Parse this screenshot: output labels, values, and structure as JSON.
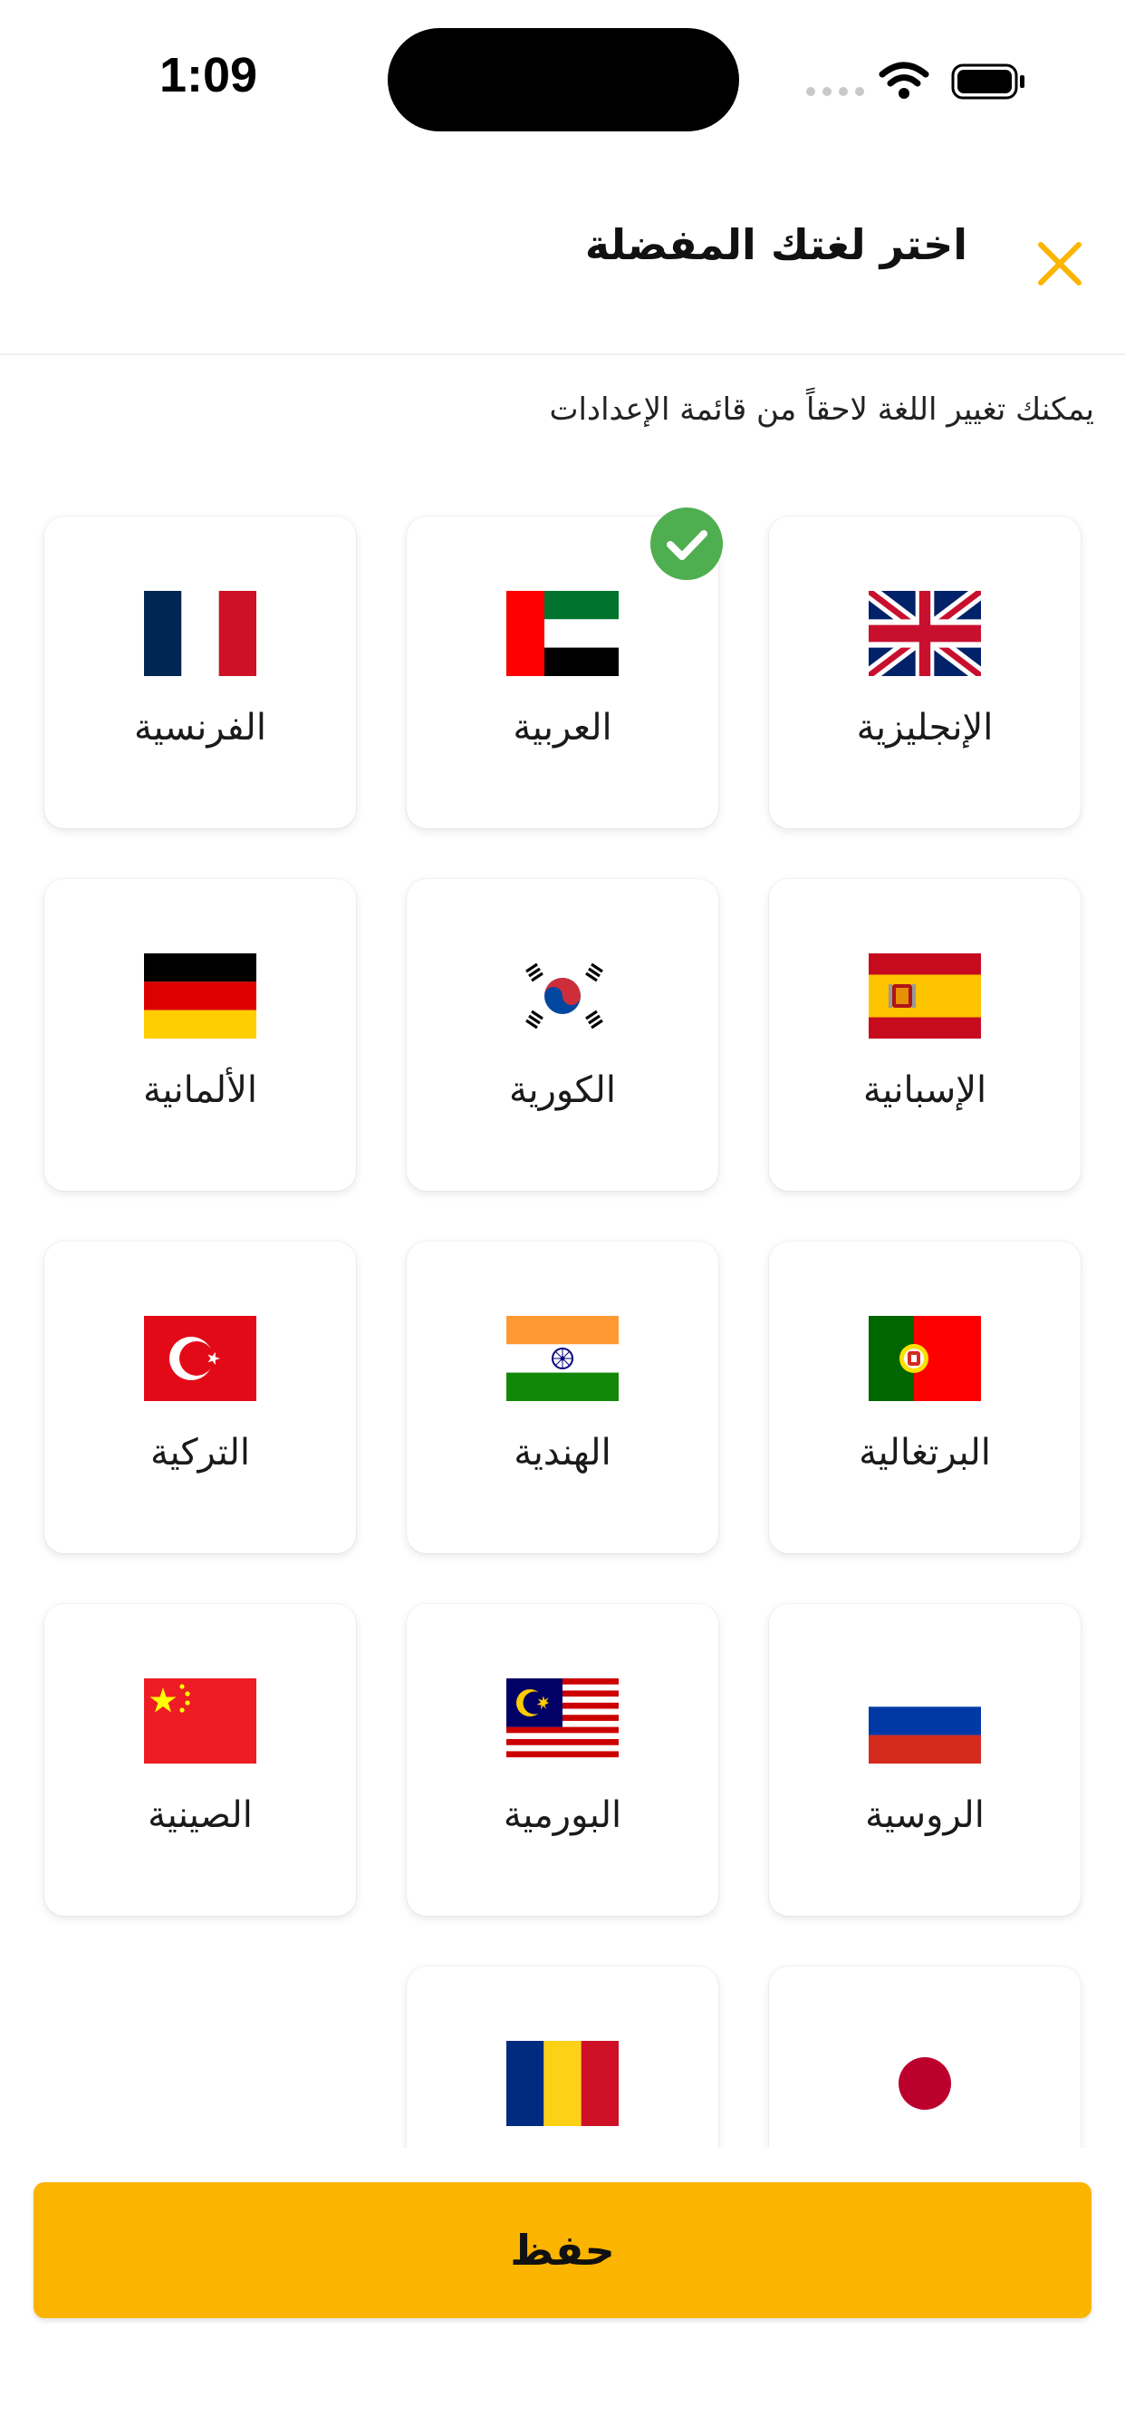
{
  "status_bar": {
    "time": "1:09"
  },
  "header": {
    "title": "اختر لغتك المفضلة",
    "close_icon": "close-icon"
  },
  "subtitle": "يمكنك تغيير اللغة لاحقاً من قائمة الإعدادات",
  "languages": [
    {
      "label": "الإنجليزية",
      "flag": "uk-flag-icon",
      "selected": false
    },
    {
      "label": "العربية",
      "flag": "uae-flag-icon",
      "selected": true
    },
    {
      "label": "الفرنسية",
      "flag": "france-flag-icon",
      "selected": false
    },
    {
      "label": "الإسبانية",
      "flag": "spain-flag-icon",
      "selected": false
    },
    {
      "label": "الكورية",
      "flag": "korea-flag-icon",
      "selected": false
    },
    {
      "label": "الألمانية",
      "flag": "germany-flag-icon",
      "selected": false
    },
    {
      "label": "البرتغالية",
      "flag": "portugal-flag-icon",
      "selected": false
    },
    {
      "label": "الهندية",
      "flag": "india-flag-icon",
      "selected": false
    },
    {
      "label": "التركية",
      "flag": "turkey-flag-icon",
      "selected": false
    },
    {
      "label": "الروسية",
      "flag": "russia-flag-icon",
      "selected": false
    },
    {
      "label": "البورمية",
      "flag": "malaysia-flag-icon",
      "selected": false
    },
    {
      "label": "الصينية",
      "flag": "china-flag-icon",
      "selected": false
    },
    {
      "label": "",
      "flag": "japan-flag-icon",
      "selected": false
    },
    {
      "label": "",
      "flag": "romania-flag-icon",
      "selected": false
    }
  ],
  "save_button": {
    "label": "حفظ"
  },
  "colors": {
    "accent": "#fbb400",
    "check": "#4fae4f"
  }
}
